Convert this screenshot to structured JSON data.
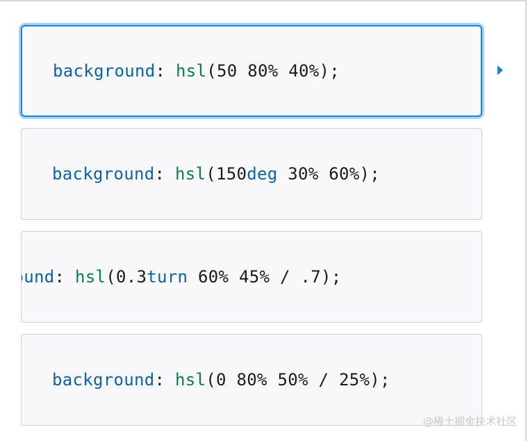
{
  "options": [
    {
      "property": "background",
      "colon": ":",
      "func": "hsl",
      "open": "(",
      "args_before_unit": "50 80% 40%",
      "unit": "",
      "args_after_unit": "",
      "close": ");"
    },
    {
      "property": "background",
      "colon": ":",
      "func": "hsl",
      "open": "(",
      "args_before_unit": "150",
      "unit": "deg",
      "args_after_unit": " 30% 60%",
      "close": ");"
    },
    {
      "property": "background",
      "colon": ":",
      "func": "hsl",
      "open": "(",
      "args_before_unit": "0.3",
      "unit": "turn",
      "args_after_unit": " 60% 45% / .7",
      "close": ");"
    },
    {
      "property": "background",
      "colon": ":",
      "func": "hsl",
      "open": "(",
      "args_before_unit": "0 80% 50% / 25%",
      "unit": "",
      "args_after_unit": "",
      "close": ");"
    }
  ],
  "selected_index": 0,
  "watermark": "@稀土掘金技术社区",
  "colors": {
    "selected_border": "#1d83d6",
    "selected_glow": "#a8d0f4",
    "property_text": "#0b63a8",
    "function_text": "#0a7d4f"
  },
  "icons": {
    "selection_arrow": "caret-right-icon"
  }
}
